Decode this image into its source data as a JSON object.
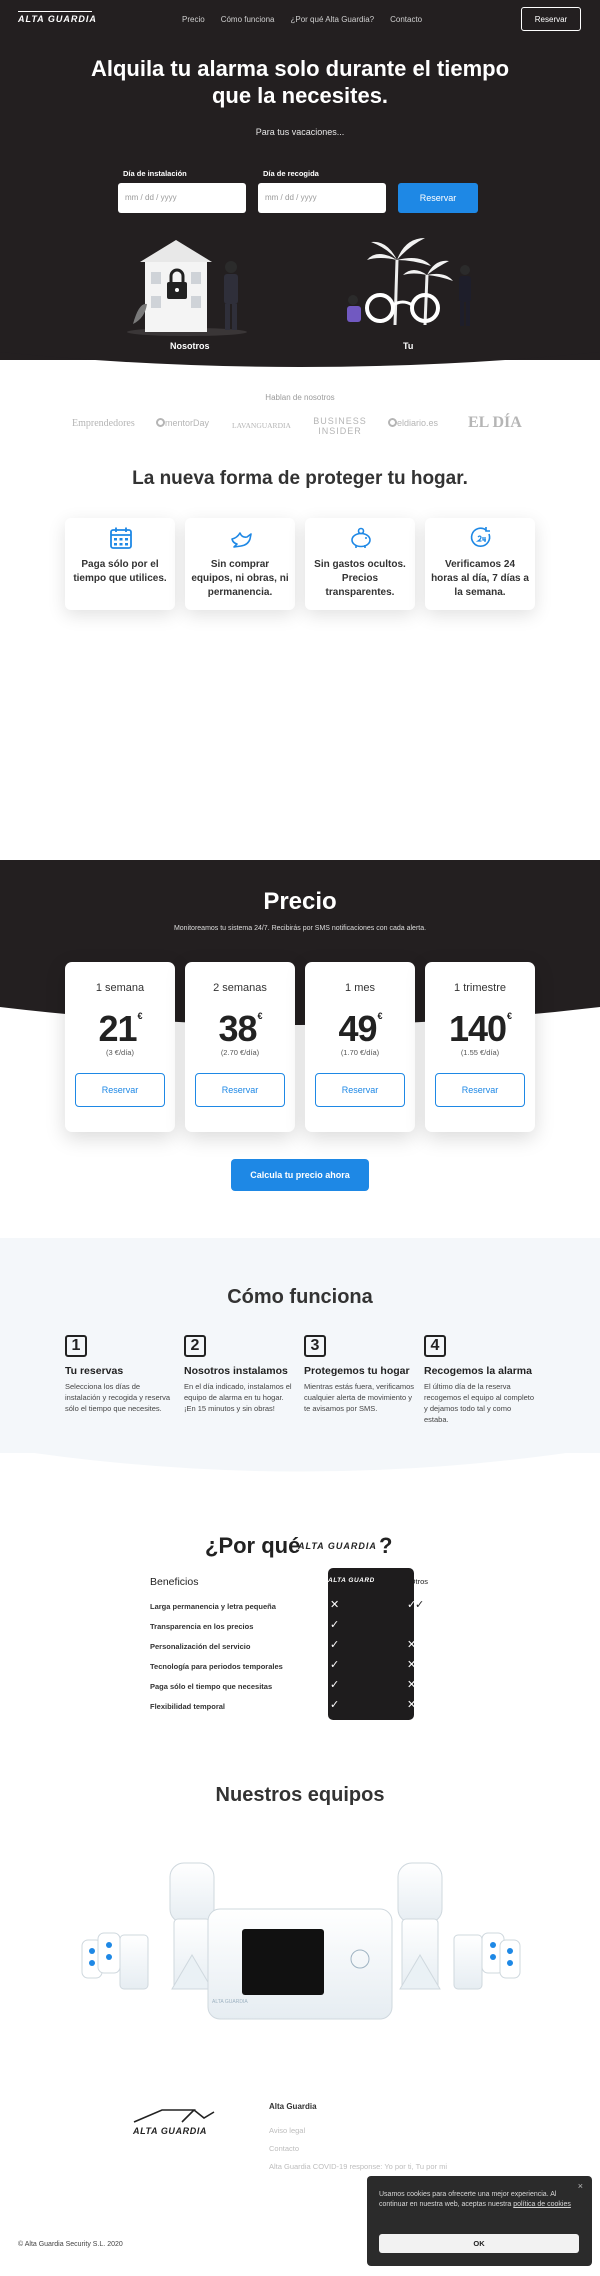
{
  "nav": {
    "logo": "ALTA GUARDIA",
    "links": [
      "Precio",
      "Cómo funciona",
      "¿Por qué Alta Guardia?",
      "Contacto"
    ],
    "cta": "Reservar"
  },
  "hero": {
    "title": "Alquila tu alarma solo durante el tiempo que la necesites.",
    "subtitle": "Para tus vacaciones...",
    "install_label": "Día de instalación",
    "pickup_label": "Día de recogida",
    "date_placeholder": "mm / dd / yyyy",
    "button": "Reservar",
    "caption_left": "Nosotros",
    "caption_right": "Tu"
  },
  "press": {
    "title": "Hablan de nosotros",
    "logos": [
      "Emprendedores",
      "mentorDay",
      "LAVANGUARDIA",
      "BUSINESS INSIDER",
      "eldiario.es",
      "EL DÍA"
    ]
  },
  "features": {
    "title": "La nueva forma de proteger tu hogar.",
    "items": [
      {
        "icon": "calendar-icon",
        "text": "Paga sólo por el tiempo que utilices."
      },
      {
        "icon": "dove-icon",
        "text": "Sin comprar equipos, ni obras, ni permanencia."
      },
      {
        "icon": "piggy-bank-icon",
        "text": "Sin gastos ocultos. Precios transparentes."
      },
      {
        "icon": "clock-24-icon",
        "text": "Verificamos 24 horas al día, 7 días a la semana."
      }
    ]
  },
  "pricing": {
    "title": "Precio",
    "subtitle": "Monitoreamos tu sistema 24/7. Recibirás por SMS notificaciones con cada alerta.",
    "currency": "€",
    "plans": [
      {
        "name": "1 semana",
        "price": "21",
        "per_day": "(3 €/día)",
        "button": "Reservar"
      },
      {
        "name": "2 semanas",
        "price": "38",
        "per_day": "(2.70 €/día)",
        "button": "Reservar"
      },
      {
        "name": "1 mes",
        "price": "49",
        "per_day": "(1.70 €/día)",
        "button": "Reservar"
      },
      {
        "name": "1 trimestre",
        "price": "140",
        "per_day": "(1.55 €/día)",
        "button": "Reservar"
      }
    ],
    "calc_button": "Calcula tu precio ahora"
  },
  "how": {
    "title": "Cómo funciona",
    "steps": [
      {
        "num": "1",
        "title": "Tu reservas",
        "desc": "Selecciona los días de instalación y recogida y reserva sólo el tiempo que necesites."
      },
      {
        "num": "2",
        "title": "Nosotros instalamos",
        "desc": "En el día indicado, instalamos el equipo de alarma en tu hogar. ¡En 15 minutos y sin obras!"
      },
      {
        "num": "3",
        "title": "Protegemos tu hogar",
        "desc": "Mientras estás fuera, verificamos cualquier alerta de movimiento y te avisamos por SMS."
      },
      {
        "num": "4",
        "title": "Recogemos la alarma",
        "desc": "El último día de la reserva recogemos el equipo al completo y dejamos todo tal y como estaba."
      }
    ]
  },
  "why": {
    "title": "¿Por qué",
    "logo": "ALTA GUARDIA",
    "question_mark": "?",
    "header": "Beneficios",
    "col_brand": "ALTA GUARDIA",
    "col_others": "Otros",
    "rows": [
      "Larga permanencia y letra pequeña",
      "Transparencia en los precios",
      "Personalización del servicio",
      "Tecnología para periodos temporales",
      "Paga sólo el tiempo que necesitas",
      "Flexibilidad temporal"
    ]
  },
  "equipment": {
    "title": "Nuestros equipos",
    "screen_label": "ALTA GUARDIA"
  },
  "footer": {
    "logo": "ALTA GUARDIA",
    "col_title": "Alta Guardia",
    "links": [
      "Aviso legal",
      "Contacto",
      "Alta Guardia COVID-19 response: Yo por ti, Tu por mi"
    ],
    "copyright": "© Alta Guardia Security S.L. 2020"
  },
  "cookie": {
    "text": "Usamos cookies para ofrecerte una mejor experiencia. Al continuar en nuestra web, aceptas nuestra",
    "link": "política de cookies",
    "button": "OK",
    "close": "×"
  },
  "colors": {
    "dark": "#231f20",
    "accent": "#1e88e5",
    "light_band": "#f4f7fa"
  }
}
